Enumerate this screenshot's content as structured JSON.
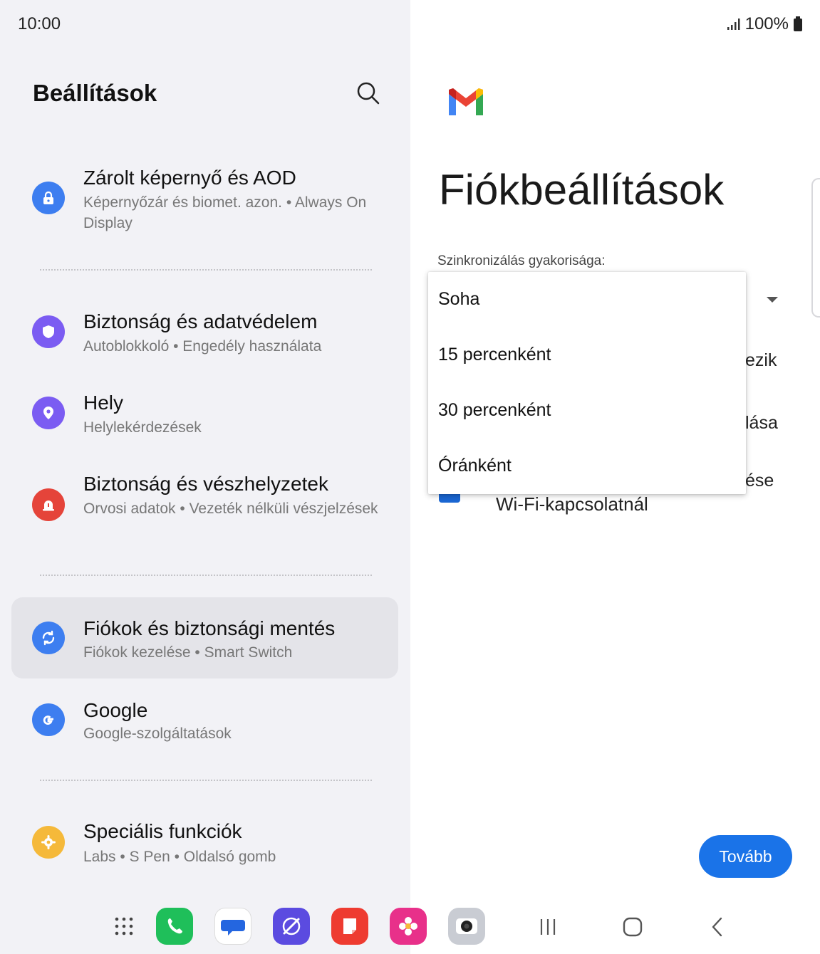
{
  "status": {
    "time": "10:00",
    "battery": "100%"
  },
  "left": {
    "title": "Beállítások",
    "items": [
      {
        "title": "Zárolt képernyő és AOD",
        "subtitle": "Képernyőzár és biomet. azon.  •  Always On Display",
        "color": "#3d7ef0",
        "icon": "lock-icon"
      },
      {
        "title": "Biztonság és adatvédelem",
        "subtitle": "Autoblokkoló  •  Engedély használata",
        "color": "#7b5cf2",
        "icon": "shield-icon"
      },
      {
        "title": "Hely",
        "subtitle": "Helylekérdezések",
        "color": "#7b5cf2",
        "icon": "location-pin-icon"
      },
      {
        "title": "Biztonság és vészhelyzetek",
        "subtitle": "Orvosi adatok  •  Vezeték nélküli vészjelzések",
        "color": "#e5443a",
        "icon": "emergency-icon"
      },
      {
        "title": "Fiókok és biztonsági mentés",
        "subtitle": "Fiókok kezelése  •  Smart Switch",
        "color": "#3d7ef0",
        "icon": "sync-icon"
      },
      {
        "title": "Google",
        "subtitle": "Google-szolgáltatások",
        "color": "#3d7ef0",
        "icon": "google-icon"
      },
      {
        "title": "Speciális funkciók",
        "subtitle": "Labs  •  S Pen  •  Oldalsó gomb",
        "color": "#f5b93a",
        "icon": "gear-icon"
      }
    ]
  },
  "right": {
    "title": "Fiókbeállítások",
    "sync_label": "Szinkronizálás gyakorisága:",
    "dropdown_options": [
      "Soha",
      "15 percenként",
      "30 percenként",
      "Óránként"
    ],
    "partial_texts": [
      "ezik",
      "lása",
      "ése"
    ],
    "wifi_label": "Wi-Fi-kapcsolatnál",
    "next_label": "Tovább"
  },
  "dock": {
    "apps": [
      "apps-grid-icon",
      "phone-icon",
      "messages-icon",
      "internet-icon",
      "notes-icon",
      "gallery-icon",
      "camera-icon"
    ]
  }
}
